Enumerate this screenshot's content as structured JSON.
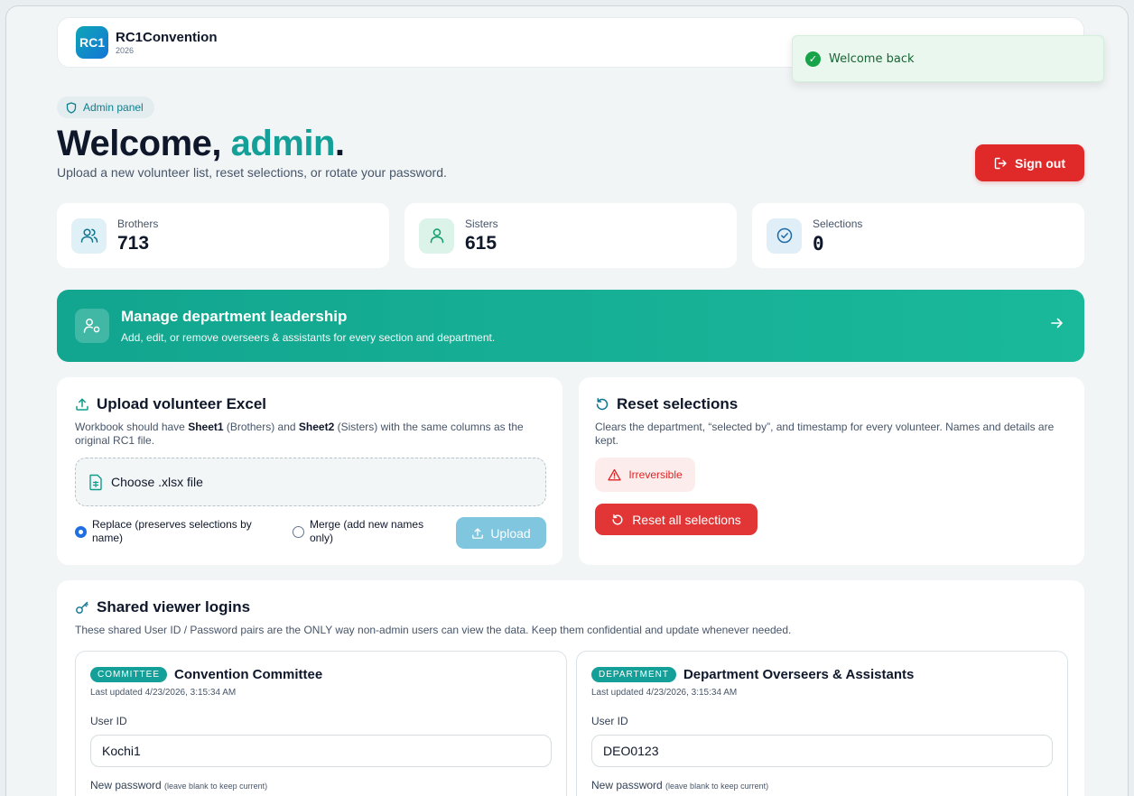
{
  "header": {
    "logo_text": "RC1",
    "app_name": "RC1Convention",
    "year": "2026"
  },
  "toast": {
    "message": "Welcome back"
  },
  "welcome": {
    "pill": "Admin panel",
    "greeting": "Welcome, ",
    "user": "admin",
    "punct": ".",
    "subtitle": "Upload a new volunteer list, reset selections, or rotate your password.",
    "signout_label": "Sign out"
  },
  "stats": [
    {
      "label": "Brothers",
      "value": "713"
    },
    {
      "label": "Sisters",
      "value": "615"
    },
    {
      "label": "Selections",
      "value": "0"
    }
  ],
  "manage": {
    "title": "Manage department leadership",
    "subtitle": "Add, edit, or remove overseers & assistants for every section and department."
  },
  "upload": {
    "title": "Upload volunteer Excel",
    "desc_1": "Workbook should have ",
    "sheet1": "Sheet1",
    "desc_2": " (Brothers) and ",
    "sheet2": "Sheet2",
    "desc_3": " (Sisters) with the same columns as the original RC1 file.",
    "choose_label": "Choose .xlsx file",
    "replace_label": "Replace (preserves selections by name)",
    "merge_label": "Merge (add new names only)",
    "upload_label": "Upload"
  },
  "reset": {
    "title": "Reset selections",
    "desc": "Clears the department, “selected by”, and timestamp for every volunteer. Names and details are kept.",
    "warning": "Irreversible",
    "button_label": "Reset all selections"
  },
  "logins": {
    "title": "Shared viewer logins",
    "desc": "These shared User ID / Password pairs are the ONLY way non-admin users can view the data. Keep them confidential and update whenever needed.",
    "cards": [
      {
        "badge": "COMMITTEE",
        "title": "Convention Committee",
        "updated": "Last updated 4/23/2026, 3:15:34 AM",
        "user_id_label": "User ID",
        "user_id": "Kochi1",
        "password_label": "New password",
        "password_hint": "(leave blank to keep current)"
      },
      {
        "badge": "DEPARTMENT",
        "title": "Department Overseers & Assistants",
        "updated": "Last updated 4/23/2026, 3:15:34 AM",
        "user_id_label": "User ID",
        "user_id": "DEO0123",
        "password_label": "New password",
        "password_hint": "(leave blank to keep current)"
      }
    ]
  }
}
